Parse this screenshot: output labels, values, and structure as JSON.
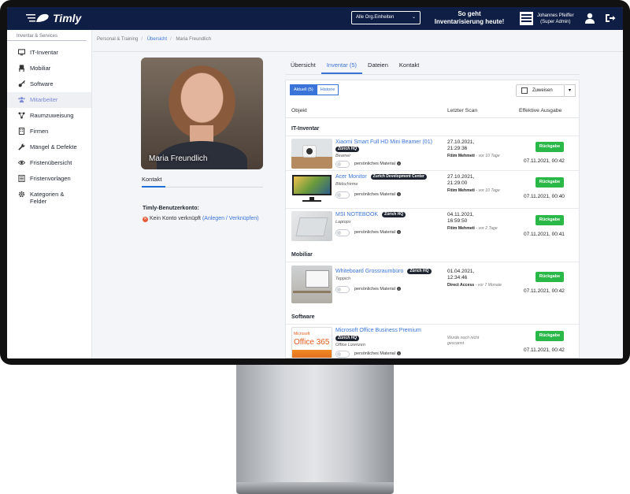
{
  "header": {
    "logo_text": "Timly",
    "org_select": "Alle Org.Einheiten",
    "promo_line1": "So geht",
    "promo_line2": "Inventarisierung heute!",
    "user_name": "Johannes Pfeiffer",
    "user_role": "(Super Admin)"
  },
  "sidebar": {
    "title": "Inventar & Services",
    "items": [
      {
        "label": "IT-Inventar",
        "icon": "monitor-icon"
      },
      {
        "label": "Mobiliar",
        "icon": "chair-icon"
      },
      {
        "label": "Software",
        "icon": "key-icon"
      },
      {
        "label": "Mitarbeiter",
        "icon": "users-icon"
      },
      {
        "label": "Raumzuweisung",
        "icon": "network-icon"
      },
      {
        "label": "Firmen",
        "icon": "building-icon"
      },
      {
        "label": "Mängel & Defekte",
        "icon": "wrench-icon"
      },
      {
        "label": "Fristenübersicht",
        "icon": "eye-icon"
      },
      {
        "label": "Fristenvorlagen",
        "icon": "list-icon"
      },
      {
        "label": "Kategorien &",
        "label2": "Felder",
        "icon": "gear-icon"
      }
    ]
  },
  "breadcrumb": {
    "item1": "Personal & Training",
    "item2": "Übersicht",
    "item3": "Maria Freundlich"
  },
  "profile": {
    "name": "Maria Freundlich",
    "contact_tab": "Kontakt",
    "account_title": "Timly-Benutzerkonto:",
    "account_status": "Kein Konto verknüpft",
    "account_link": "(Anlegen / Verknüpfen)"
  },
  "tabs": [
    "Übersicht",
    "Inventar (5)",
    "Dateien",
    "Kontakt"
  ],
  "panel": {
    "seg_current": "Aktuell (5)",
    "seg_history": "Historie",
    "assign_label": "Zuweisen",
    "col_object": "Objekt",
    "col_scan": "Letzter Scan",
    "col_output": "Effektive Ausgabe",
    "toggle_label": "persönliches Material",
    "return_label": "Rückgabe",
    "sections": {
      "it": "IT-Inventar",
      "mobiliar": "Mobiliar",
      "software": "Software"
    },
    "rows": [
      {
        "title": "Xiaomi Smart Full HD Mini Beamer (01)",
        "badge": "Zürich HQ",
        "category": "Beamer",
        "scan_date": "27.10.2021,",
        "scan_time": "21:29:36",
        "scan_by": "Fitim Mehmeti",
        "scan_ago": "- vor 10 Tage",
        "output": "07.11.2021, 00:42"
      },
      {
        "title": "Acer Monitor",
        "badge": "Zurich Development Center",
        "category": "Bildschirme",
        "scan_date": "27.10.2021,",
        "scan_time": "21:29:00",
        "scan_by": "Fitim Mehmeti",
        "scan_ago": "- vor 10 Tage",
        "output": "07.11.2021, 00:40"
      },
      {
        "title": "MSI NOTEBOOK",
        "badge": "Zürich HQ",
        "category": "Laptops",
        "scan_date": "04.11.2021,",
        "scan_time": "16:59:50",
        "scan_by": "Fitim Mehmeti",
        "scan_ago": "- vor 2 Tage",
        "output": "07.11.2021, 00:41"
      },
      {
        "title": "Whiteboard Grossraumbüro",
        "badge": "Zürich HQ",
        "category": "Teppich",
        "scan_date": "01.04.2021,",
        "scan_time": "12:34:46",
        "scan_by": "Direct Access",
        "scan_ago": "- vor 7 Monate",
        "output": "07.11.2021, 00:42"
      },
      {
        "title": "Microsoft Office Business Premium",
        "badge": "Zürich HQ",
        "category": "Office Lizenzen",
        "scan_note": "Wurde noch nicht gescannt",
        "thumb_text1": "Microsoft",
        "thumb_text2": "Office 365",
        "output": "07.11.2021, 00:42"
      }
    ]
  },
  "colors": {
    "header_bg": "#0f1e45",
    "accent": "#3a74d8",
    "success": "#2ab848"
  }
}
